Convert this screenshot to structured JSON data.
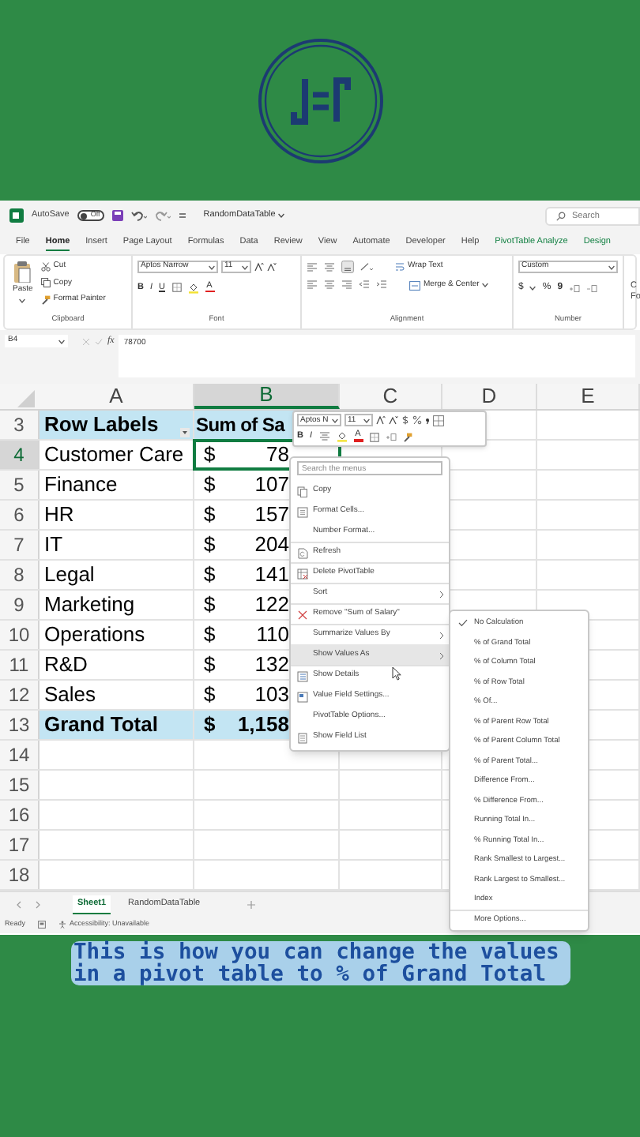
{
  "title_bar": {
    "autosave_label": "AutoSave",
    "autosave_toggle": {
      "label": "Off",
      "on": false
    },
    "file_name": "RandomDataTable",
    "search_placeholder": "Search"
  },
  "ribbon_tabs": [
    {
      "label": "File",
      "selected": false,
      "contextual": false
    },
    {
      "label": "Home",
      "selected": true,
      "contextual": false
    },
    {
      "label": "Insert",
      "selected": false,
      "contextual": false
    },
    {
      "label": "Page Layout",
      "selected": false,
      "contextual": false
    },
    {
      "label": "Formulas",
      "selected": false,
      "contextual": false
    },
    {
      "label": "Data",
      "selected": false,
      "contextual": false
    },
    {
      "label": "Review",
      "selected": false,
      "contextual": false
    },
    {
      "label": "View",
      "selected": false,
      "contextual": false
    },
    {
      "label": "Automate",
      "selected": false,
      "contextual": false
    },
    {
      "label": "Developer",
      "selected": false,
      "contextual": false
    },
    {
      "label": "Help",
      "selected": false,
      "contextual": false
    },
    {
      "label": "PivotTable Analyze",
      "selected": false,
      "contextual": true
    },
    {
      "label": "Design",
      "selected": false,
      "contextual": true
    }
  ],
  "ribbon": {
    "clipboard": {
      "paste": "Paste",
      "cut": "Cut",
      "copy": "Copy",
      "format_painter": "Format Painter",
      "label": "Clipboard"
    },
    "font": {
      "font_name": "Aptos Narrow",
      "font_size": "11",
      "bold": "B",
      "italic": "I",
      "underline": "U",
      "font_color": "A",
      "label": "Font"
    },
    "alignment": {
      "wrap_text": "Wrap Text",
      "merge_center": "Merge & Center",
      "label": "Alignment"
    },
    "number": {
      "format": "Custom",
      "currency": "$",
      "percent": "%",
      "comma": "9",
      "label": "Number"
    },
    "cut_off_group": {
      "line_1": "C",
      "line_2": "Fo"
    }
  },
  "formula_bar": {
    "name_box": "B4",
    "function_label": "fx",
    "value": "78700"
  },
  "columns": [
    {
      "label": "A",
      "selected": false
    },
    {
      "label": "B",
      "selected": true
    },
    {
      "label": "C",
      "selected": false
    },
    {
      "label": "D",
      "selected": false
    },
    {
      "label": "E",
      "selected": false
    }
  ],
  "rows": [
    {
      "number": "3",
      "kind": "header",
      "selected": false,
      "label": "Row Labels",
      "value": "Sum of Sa"
    },
    {
      "number": "4",
      "kind": "item",
      "selected": true,
      "label": "Customer Care",
      "currency": "$",
      "value": "78"
    },
    {
      "number": "5",
      "kind": "item",
      "selected": false,
      "label": "Finance",
      "currency": "$",
      "value": "107"
    },
    {
      "number": "6",
      "kind": "item",
      "selected": false,
      "label": "HR",
      "currency": "$",
      "value": "157"
    },
    {
      "number": "7",
      "kind": "item",
      "selected": false,
      "label": "IT",
      "currency": "$",
      "value": "204"
    },
    {
      "number": "8",
      "kind": "item",
      "selected": false,
      "label": "Legal",
      "currency": "$",
      "value": "141"
    },
    {
      "number": "9",
      "kind": "item",
      "selected": false,
      "label": "Marketing",
      "currency": "$",
      "value": "122"
    },
    {
      "number": "10",
      "kind": "item",
      "selected": false,
      "label": "Operations",
      "currency": "$",
      "value": "110"
    },
    {
      "number": "11",
      "kind": "item",
      "selected": false,
      "label": "R&D",
      "currency": "$",
      "value": "132"
    },
    {
      "number": "12",
      "kind": "item",
      "selected": false,
      "label": "Sales",
      "currency": "$",
      "value": "103"
    },
    {
      "number": "13",
      "kind": "total",
      "selected": false,
      "label": "Grand Total",
      "currency": "$",
      "value": "1,158"
    },
    {
      "number": "14",
      "kind": "empty",
      "selected": false
    },
    {
      "number": "15",
      "kind": "empty",
      "selected": false
    },
    {
      "number": "16",
      "kind": "empty",
      "selected": false
    },
    {
      "number": "17",
      "kind": "empty",
      "selected": false
    },
    {
      "number": "18",
      "kind": "empty",
      "selected": false
    }
  ],
  "mini_toolbar": {
    "font_name": "Aptos N",
    "font_size": "11",
    "bold": "B",
    "italic": "I",
    "font_color": "A"
  },
  "context_menu": {
    "search_placeholder": "Search the menus",
    "items": [
      {
        "label": "Copy",
        "kind": "copy",
        "submenu": false,
        "divider_before": false,
        "highlighted": false
      },
      {
        "label": "Format Cells...",
        "kind": "cells",
        "submenu": false,
        "divider_before": false,
        "highlighted": false
      },
      {
        "label": "Number Format...",
        "kind": "plain",
        "submenu": false,
        "divider_before": false,
        "highlighted": false
      },
      {
        "label": "Refresh",
        "kind": "refresh",
        "submenu": false,
        "divider_before": true,
        "highlighted": false
      },
      {
        "label": "Delete PivotTable",
        "kind": "table",
        "submenu": false,
        "divider_before": true,
        "highlighted": false
      },
      {
        "label": "Sort",
        "kind": "plain",
        "submenu": true,
        "divider_before": true,
        "highlighted": false
      },
      {
        "label": "Remove \"Sum of Salary\"",
        "kind": "remove",
        "submenu": false,
        "divider_before": true,
        "highlighted": false
      },
      {
        "label": "Summarize Values By",
        "kind": "plain",
        "submenu": true,
        "divider_before": true,
        "highlighted": false
      },
      {
        "label": "Show Values As",
        "kind": "plain",
        "submenu": true,
        "divider_before": false,
        "highlighted": true
      },
      {
        "label": "Show Details",
        "kind": "details",
        "submenu": false,
        "divider_before": true,
        "highlighted": false
      },
      {
        "label": "Value Field Settings...",
        "kind": "settings",
        "submenu": false,
        "divider_before": false,
        "highlighted": false
      },
      {
        "label": "PivotTable Options...",
        "kind": "plain",
        "submenu": false,
        "divider_before": false,
        "highlighted": false
      },
      {
        "label": "Show Field List",
        "kind": "fieldlist",
        "submenu": false,
        "divider_before": false,
        "highlighted": false
      }
    ]
  },
  "submenu": {
    "items": [
      {
        "label": "No Calculation",
        "checked": true,
        "divider_before": false
      },
      {
        "label": "% of Grand Total",
        "checked": false,
        "divider_before": false
      },
      {
        "label": "% of Column Total",
        "checked": false,
        "divider_before": false
      },
      {
        "label": "% of Row Total",
        "checked": false,
        "divider_before": false
      },
      {
        "label": "% Of...",
        "checked": false,
        "divider_before": false
      },
      {
        "label": "% of Parent Row Total",
        "checked": false,
        "divider_before": false
      },
      {
        "label": "% of Parent Column Total",
        "checked": false,
        "divider_before": false
      },
      {
        "label": "% of Parent Total...",
        "checked": false,
        "divider_before": false
      },
      {
        "label": "Difference From...",
        "checked": false,
        "divider_before": false
      },
      {
        "label": "% Difference From...",
        "checked": false,
        "divider_before": false
      },
      {
        "label": "Running Total In...",
        "checked": false,
        "divider_before": false
      },
      {
        "label": "% Running Total In...",
        "checked": false,
        "divider_before": false
      },
      {
        "label": "Rank Smallest to Largest...",
        "checked": false,
        "divider_before": false
      },
      {
        "label": "Rank Largest to Smallest...",
        "checked": false,
        "divider_before": false
      },
      {
        "label": "Index",
        "checked": false,
        "divider_before": false
      },
      {
        "label": "More Options...",
        "checked": false,
        "divider_before": true
      }
    ]
  },
  "sheet_tabs": [
    {
      "label": "Sheet1",
      "selected": true
    },
    {
      "label": "RandomDataTable",
      "selected": false
    }
  ],
  "status_bar": {
    "ready": "Ready",
    "accessibility": "Accessibility: Unavailable"
  },
  "caption": "This is how you can change the values in a pivot table to % of Grand Total"
}
